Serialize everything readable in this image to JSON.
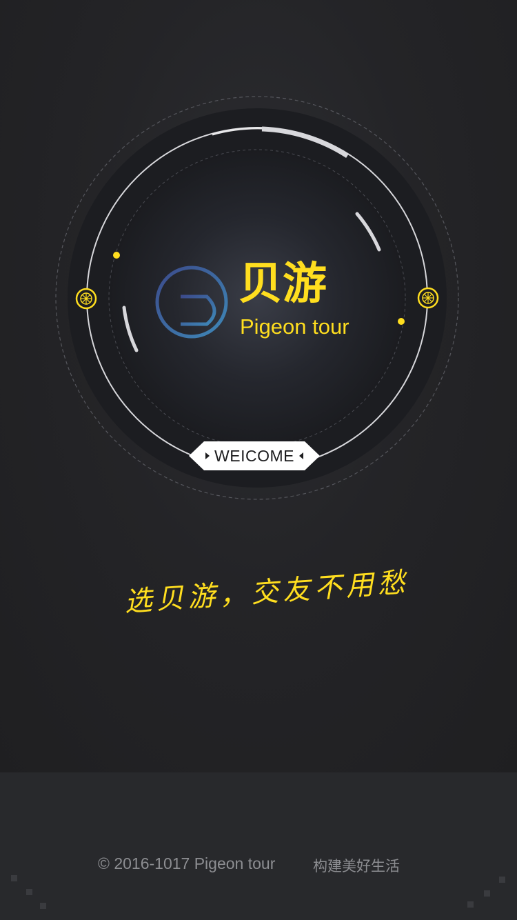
{
  "brand": {
    "title": "贝游",
    "subtitle": "Pigeon tour",
    "logo_icon": "pigeon-tour-logo-icon"
  },
  "welcome": {
    "label": "WEICOME"
  },
  "slogan": {
    "text": "选贝游，交友不用愁"
  },
  "footer": {
    "copyright": "©  2016-1017 Pigeon tour",
    "tagline": "构建美好生活"
  },
  "colors": {
    "accent": "#ffde1f",
    "background": "#232325",
    "footer_background": "#28292c",
    "footer_text": "#8d8e92",
    "ring": "#d8d8dc"
  }
}
